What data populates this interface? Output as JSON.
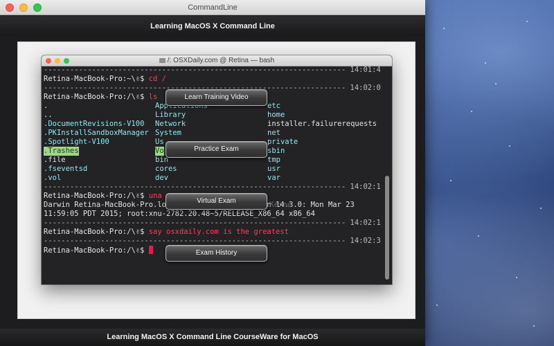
{
  "app": {
    "window_title": "CommandLine",
    "header_title": "Learning MacOS X Command Line",
    "footer_title": "Learning MacOS X Command Line CourseWare for MacOS"
  },
  "terminal": {
    "title": "/: OSXDaily.com @ Retina — bash",
    "separators": [
      {
        "dashes": "---------------------------------------------------------------------",
        "time": "14:01:4"
      },
      {
        "dashes": "---------------------------------------------------------------------",
        "time": "14:02:0"
      },
      {
        "dashes": "---------------------------------------------------------------------",
        "time": "14:02:1"
      },
      {
        "dashes": "---------------------------------------------------------------------",
        "time": "14:02:1"
      },
      {
        "dashes": "---------------------------------------------------------------------",
        "time": "14:02:3"
      }
    ],
    "prompt_home": "Retina-MacBook-Pro:~\\✌$ ",
    "prompt_root": "Retina-MacBook-Pro:/\\✌$ ",
    "commands": {
      "cd": "cd /",
      "ls": "ls",
      "uname": "una",
      "say": "say osxdaily.com is the greatest"
    },
    "ls_columns": {
      "col1": [
        ".",
        "..",
        ".DocumentRevisions-V100",
        ".PKInstallSandboxManager",
        ".Spotlight-V100",
        ".Trashes",
        ".file",
        ".fseventsd",
        ".vol"
      ],
      "col2": [
        "Applications",
        "Library",
        "Network",
        "System",
        "Us",
        "Vo",
        "bin",
        "cores",
        "dev"
      ],
      "col3": [
        "etc",
        "home",
        "installer.failurerequests",
        "net",
        "private",
        "sbin",
        "tmp",
        "usr",
        "var"
      ]
    },
    "uname_output": [
      "Darwin Retina-MacBook-Pro.lo                 Version 14.3.0: Mon Mar 23",
      "11:59:05 PDT 2015; root:xnu-2782.20.48~5/RELEASE_X86_64 x86_64"
    ],
    "uname_faded": "al 14.3.0 Darwin Kerne"
  },
  "buttons": {
    "learn": "Learn Training Video",
    "practice": "Practice Exam",
    "virtual": "Virtual Exam",
    "history": "Exam History"
  },
  "colors": {
    "command": "#ff3b5c",
    "directory": "#8ee6f0",
    "highlight": "#9ed68a",
    "cursor": "#e8194a"
  }
}
